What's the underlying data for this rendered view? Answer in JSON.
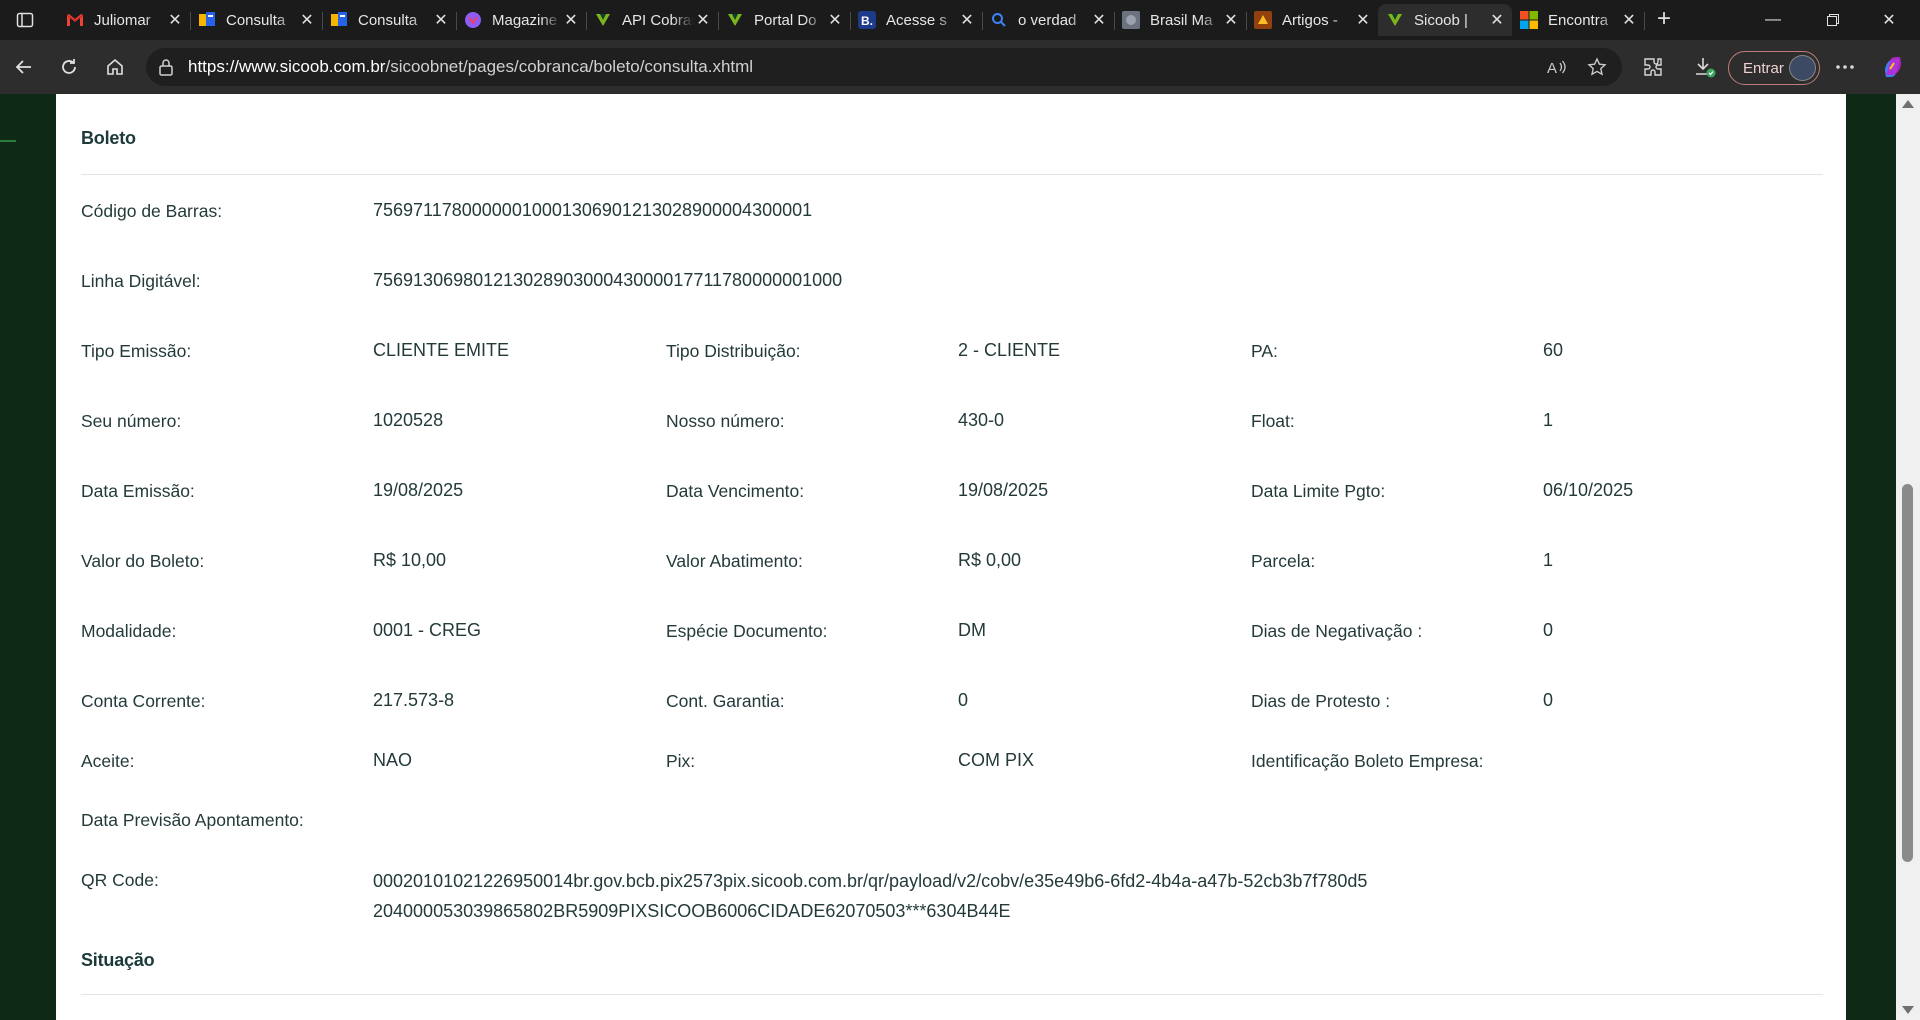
{
  "tabs": [
    {
      "title": "Juliomar",
      "icon": "gmail-icon",
      "active": false
    },
    {
      "title": "Consulta",
      "icon": "consulta-icon",
      "active": false
    },
    {
      "title": "Consulta",
      "icon": "consulta-icon",
      "active": false
    },
    {
      "title": "Magazine",
      "icon": "magazine-icon",
      "active": false
    },
    {
      "title": "API Cobrança",
      "icon": "sicoob-icon",
      "active": false
    },
    {
      "title": "Portal Do",
      "icon": "sicoob-icon",
      "active": false
    },
    {
      "title": "Acesse s",
      "icon": "b-icon",
      "active": false
    },
    {
      "title": "o verdad",
      "icon": "search-icon",
      "active": false
    },
    {
      "title": "Brasil Ma",
      "icon": "brasil-icon",
      "active": false
    },
    {
      "title": "Artigos -",
      "icon": "artigos-icon",
      "active": false
    },
    {
      "title": "Sicoob |",
      "icon": "sicoob-icon",
      "active": true
    },
    {
      "title": "Encontra",
      "icon": "microsoft-icon",
      "active": false
    }
  ],
  "address_bar": {
    "host": "https://www.sicoob.com.br",
    "path": "/sicoobnet/pages/cobranca/boleto/consulta.xhtml"
  },
  "toolbar": {
    "signin_label": "Entrar"
  },
  "boleto": {
    "section_title": "Boleto",
    "codigo_barras": {
      "label": "Código de Barras:",
      "value": "75697117800000010001306901213028900004300001"
    },
    "linha_digitavel": {
      "label": "Linha Digitável:",
      "value": "75691306980121302890300043000017711780000001000"
    },
    "rows": [
      [
        {
          "label": "Tipo Emissão:",
          "value": "CLIENTE EMITE"
        },
        {
          "label": "Tipo Distribuição:",
          "value": "2 - CLIENTE"
        },
        {
          "label": "PA:",
          "value": "60"
        }
      ],
      [
        {
          "label": "Seu número:",
          "value": "1020528"
        },
        {
          "label": "Nosso número:",
          "value": "430-0"
        },
        {
          "label": "Float:",
          "value": "1"
        }
      ],
      [
        {
          "label": "Data Emissão:",
          "value": "19/08/2025"
        },
        {
          "label": "Data Vencimento:",
          "value": "19/08/2025"
        },
        {
          "label": "Data Limite Pgto:",
          "value": "06/10/2025"
        }
      ],
      [
        {
          "label": "Valor do Boleto:",
          "value": "R$ 10,00"
        },
        {
          "label": "Valor Abatimento:",
          "value": "R$ 0,00"
        },
        {
          "label": "Parcela:",
          "value": "1"
        }
      ],
      [
        {
          "label": "Modalidade:",
          "value": "0001 - CREG"
        },
        {
          "label": "Espécie Documento:",
          "value": "DM"
        },
        {
          "label": "Dias de Negativação :",
          "value": "0"
        }
      ],
      [
        {
          "label": "Conta Corrente:",
          "value": "217.573-8"
        },
        {
          "label": "Cont. Garantia:",
          "value": "0"
        },
        {
          "label": "Dias de Protesto :",
          "value": "0"
        }
      ],
      [
        {
          "label": "Aceite:",
          "value": "NAO"
        },
        {
          "label": "Pix:",
          "value": "COM PIX"
        },
        {
          "label": "Identificação Boleto Empresa:",
          "value": ""
        }
      ]
    ],
    "data_previsao": {
      "label": "Data Previsão Apontamento:",
      "value": ""
    },
    "qr_code": {
      "label": "QR Code:",
      "value": "00020101021226950014br.gov.bcb.pix2573pix.sicoob.com.br/qr/payload/v2/cobv/e35e49b6-6fd2-4b4a-a47b-52cb3b7f780d5204000053039865802BR5909PIXSICOOB6006CIDADE62070503***6304B44E"
    }
  },
  "situacao": {
    "section_title": "Situação"
  },
  "colors": {
    "text": "#243a3a",
    "page_bg": "#0e2a17",
    "chrome_bg": "#2d2d2d",
    "tabbar_bg": "#1b1b1b"
  }
}
